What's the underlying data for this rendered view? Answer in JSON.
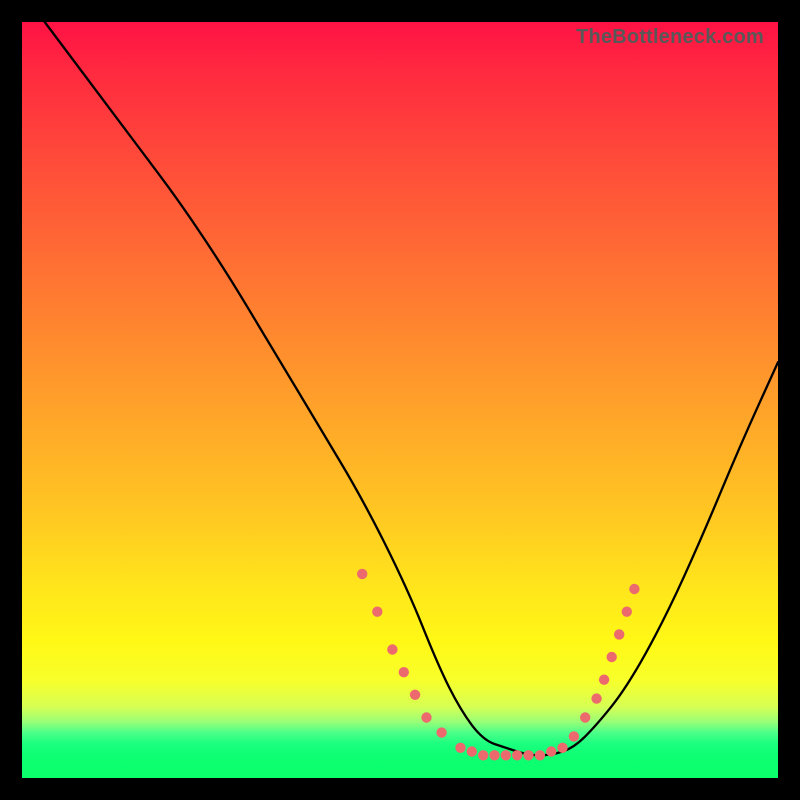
{
  "watermark": "TheBottleneck.com",
  "colors": {
    "page_bg": "#000000",
    "gradient_top": "#ff1245",
    "gradient_bottom": "#0bff6b",
    "curve": "#000000",
    "dots": "#ec6a6d",
    "watermark": "#585858"
  },
  "chart_data": {
    "type": "line",
    "title": "",
    "xlabel": "",
    "ylabel": "",
    "xlim": [
      0,
      100
    ],
    "ylim": [
      0,
      100
    ],
    "notes": "Axes have no tick labels in the image; numeric values are estimates in percent based on position within the plot area where 0 is bottom/left and 100 is top/right.",
    "series": [
      {
        "name": "V-curve",
        "x": [
          3,
          9,
          15,
          21,
          27,
          33,
          39,
          45,
          51,
          55,
          58,
          61,
          64,
          67,
          70,
          73,
          76,
          80,
          85,
          90,
          95,
          100
        ],
        "y": [
          100,
          92,
          84,
          76,
          67,
          57,
          47,
          37,
          25,
          15,
          9,
          5,
          4,
          3,
          3,
          4,
          7,
          12,
          21,
          32,
          44,
          55
        ]
      }
    ],
    "annotated_points": [
      {
        "x": 45,
        "y": 27
      },
      {
        "x": 47,
        "y": 22
      },
      {
        "x": 49,
        "y": 17
      },
      {
        "x": 50.5,
        "y": 14
      },
      {
        "x": 52,
        "y": 11
      },
      {
        "x": 53.5,
        "y": 8
      },
      {
        "x": 55.5,
        "y": 6
      },
      {
        "x": 58,
        "y": 4
      },
      {
        "x": 59.5,
        "y": 3.5
      },
      {
        "x": 61,
        "y": 3
      },
      {
        "x": 62.5,
        "y": 3
      },
      {
        "x": 64,
        "y": 3
      },
      {
        "x": 65.5,
        "y": 3
      },
      {
        "x": 67,
        "y": 3
      },
      {
        "x": 68.5,
        "y": 3
      },
      {
        "x": 70,
        "y": 3.5
      },
      {
        "x": 71.5,
        "y": 4
      },
      {
        "x": 73,
        "y": 5.5
      },
      {
        "x": 74.5,
        "y": 8
      },
      {
        "x": 76,
        "y": 10.5
      },
      {
        "x": 77,
        "y": 13
      },
      {
        "x": 78,
        "y": 16
      },
      {
        "x": 79,
        "y": 19
      },
      {
        "x": 80,
        "y": 22
      },
      {
        "x": 81,
        "y": 25
      }
    ]
  }
}
